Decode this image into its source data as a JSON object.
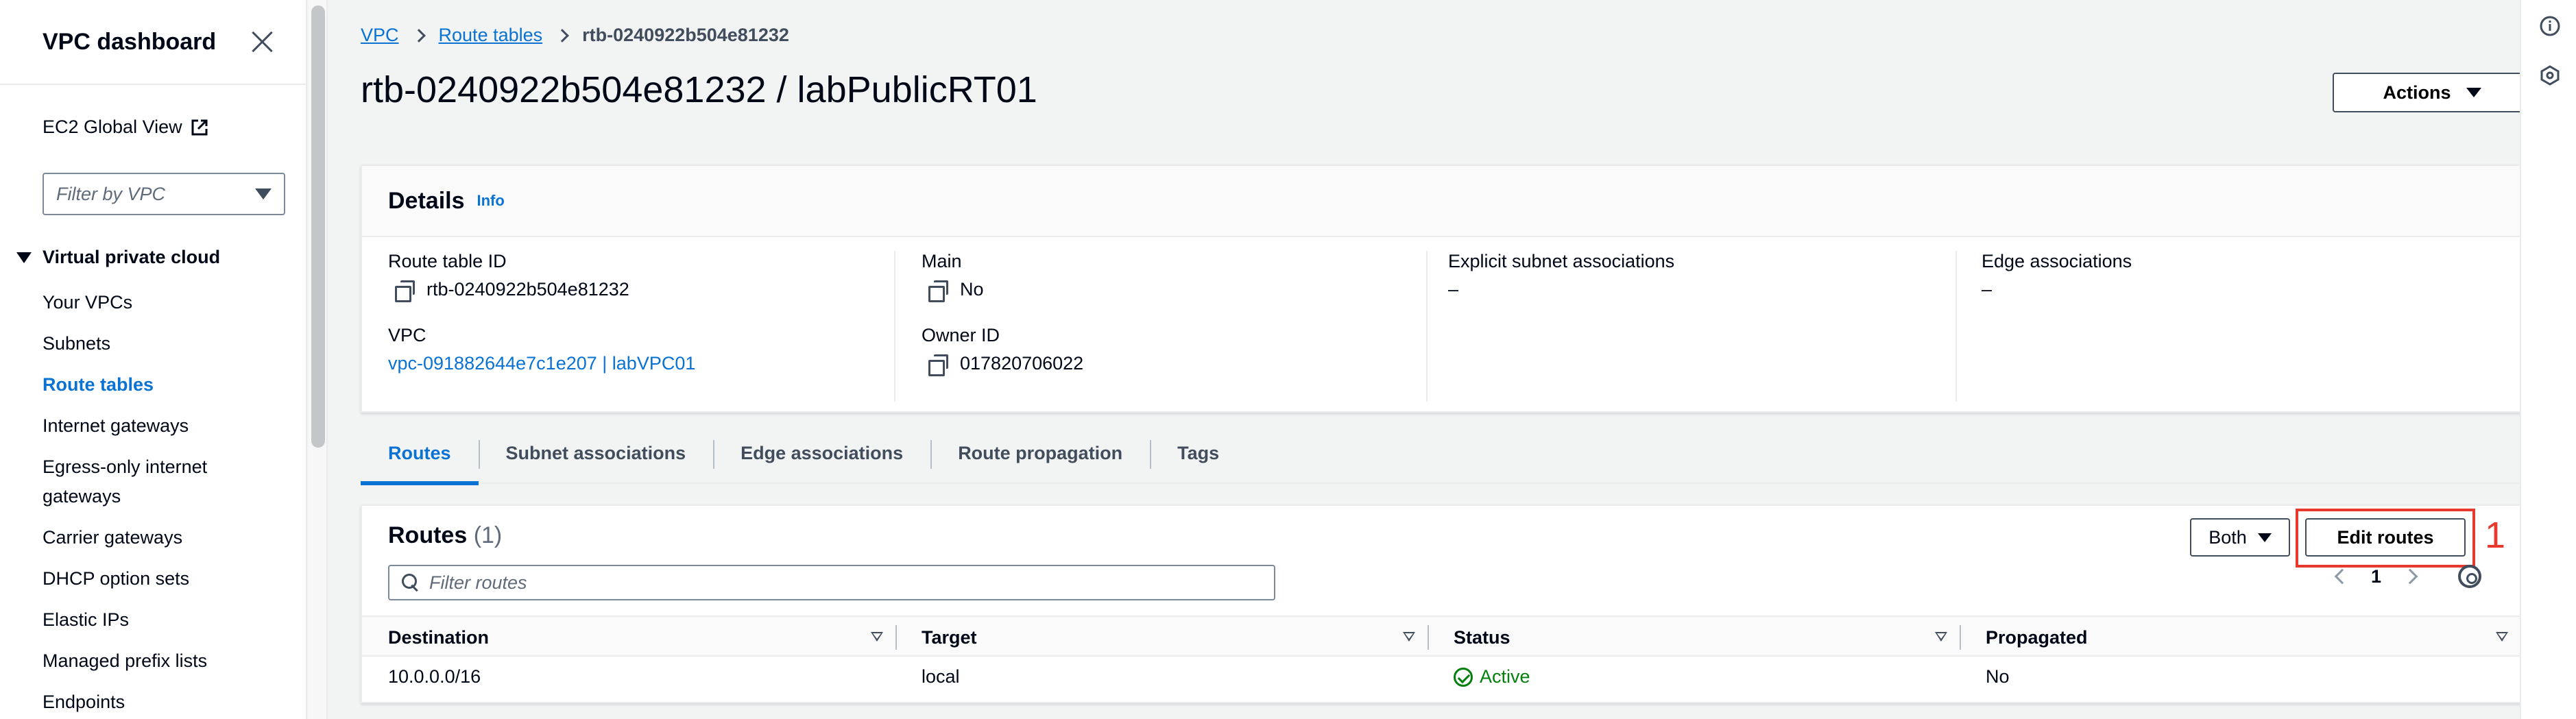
{
  "sidebar": {
    "title": "VPC dashboard",
    "ec2_global_view": "EC2 Global View",
    "filter_placeholder": "Filter by VPC",
    "section_title": "Virtual private cloud",
    "items": [
      {
        "label": "Your VPCs"
      },
      {
        "label": "Subnets"
      },
      {
        "label": "Route tables"
      },
      {
        "label": "Internet gateways"
      },
      {
        "label": "Egress-only internet gateways"
      },
      {
        "label": "Carrier gateways"
      },
      {
        "label": "DHCP option sets"
      },
      {
        "label": "Elastic IPs"
      },
      {
        "label": "Managed prefix lists"
      },
      {
        "label": "Endpoints"
      }
    ],
    "active_item": "Route tables"
  },
  "breadcrumb": {
    "items": [
      "VPC",
      "Route tables"
    ],
    "current": "rtb-0240922b504e81232"
  },
  "page": {
    "title": "rtb-0240922b504e81232 / labPublicRT01",
    "actions_label": "Actions"
  },
  "details": {
    "title": "Details",
    "info": "Info",
    "route_table_id_label": "Route table ID",
    "route_table_id": "rtb-0240922b504e81232",
    "vpc_label": "VPC",
    "vpc_value": "vpc-091882644e7c1e207 | labVPC01",
    "main_label": "Main",
    "main_value": "No",
    "owner_id_label": "Owner ID",
    "owner_id": "017820706022",
    "explicit_subnet_label": "Explicit subnet associations",
    "explicit_subnet_value": "–",
    "edge_assoc_label": "Edge associations",
    "edge_assoc_value": "–"
  },
  "tabs": [
    {
      "label": "Routes",
      "active": true
    },
    {
      "label": "Subnet associations"
    },
    {
      "label": "Edge associations"
    },
    {
      "label": "Route propagation"
    },
    {
      "label": "Tags"
    }
  ],
  "routes": {
    "title": "Routes",
    "count": "(1)",
    "filter_selected": "Both",
    "edit_label": "Edit routes",
    "annotation": "1",
    "filter_placeholder": "Filter routes",
    "page_number": "1",
    "columns": [
      "Destination",
      "Target",
      "Status",
      "Propagated"
    ],
    "rows": [
      {
        "destination": "10.0.0.0/16",
        "target": "local",
        "status": "Active",
        "propagated": "No"
      }
    ]
  },
  "colors": {
    "link": "#0972d3",
    "status_ok": "#037f0c",
    "annotation": "#e8392e"
  }
}
